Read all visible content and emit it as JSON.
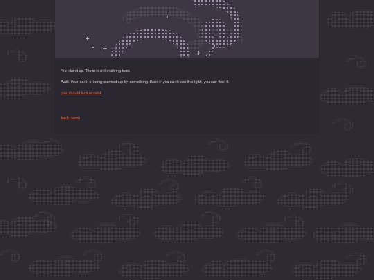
{
  "colors": {
    "background": "#2d2a33",
    "panel": "#2a2730",
    "banner": "#3d3743",
    "text": "#d9d4dc",
    "link": "#d8694a",
    "swirl": "#8a7b92"
  },
  "banner": {
    "art": "swirl-tentacle-illustration"
  },
  "story": {
    "line1": "You stand up. There is still nothing here.",
    "line2": "Wait. Your back is being warmed up by something. Even if you can't see the light, you can feel it.",
    "choice": "you should turn around"
  },
  "nav": {
    "back_label": "back home"
  }
}
